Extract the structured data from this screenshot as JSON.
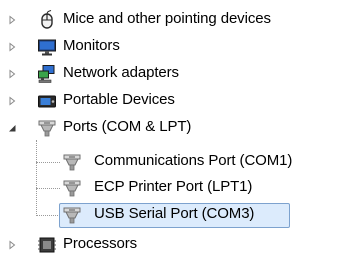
{
  "tree": {
    "items": [
      {
        "label": "Mice and other pointing devices",
        "icon": "mouse-icon",
        "expanded": false
      },
      {
        "label": "Monitors",
        "icon": "monitor-icon",
        "expanded": false
      },
      {
        "label": "Network adapters",
        "icon": "network-adapter-icon",
        "expanded": false
      },
      {
        "label": "Portable Devices",
        "icon": "portable-device-icon",
        "expanded": false
      },
      {
        "label": "Ports (COM & LPT)",
        "icon": "port-icon",
        "expanded": true,
        "children": [
          {
            "label": "Communications Port (COM1)",
            "icon": "port-icon"
          },
          {
            "label": "ECP Printer Port (LPT1)",
            "icon": "port-icon"
          },
          {
            "label": "USB Serial Port (COM3)",
            "icon": "port-icon",
            "selected": true
          }
        ]
      },
      {
        "label": "Processors",
        "icon": "processor-icon",
        "expanded": false
      }
    ]
  },
  "colors": {
    "selection_fill": "#dcebfc",
    "selection_border": "#7da2ce",
    "tree_lines": "#9a9a9a"
  }
}
